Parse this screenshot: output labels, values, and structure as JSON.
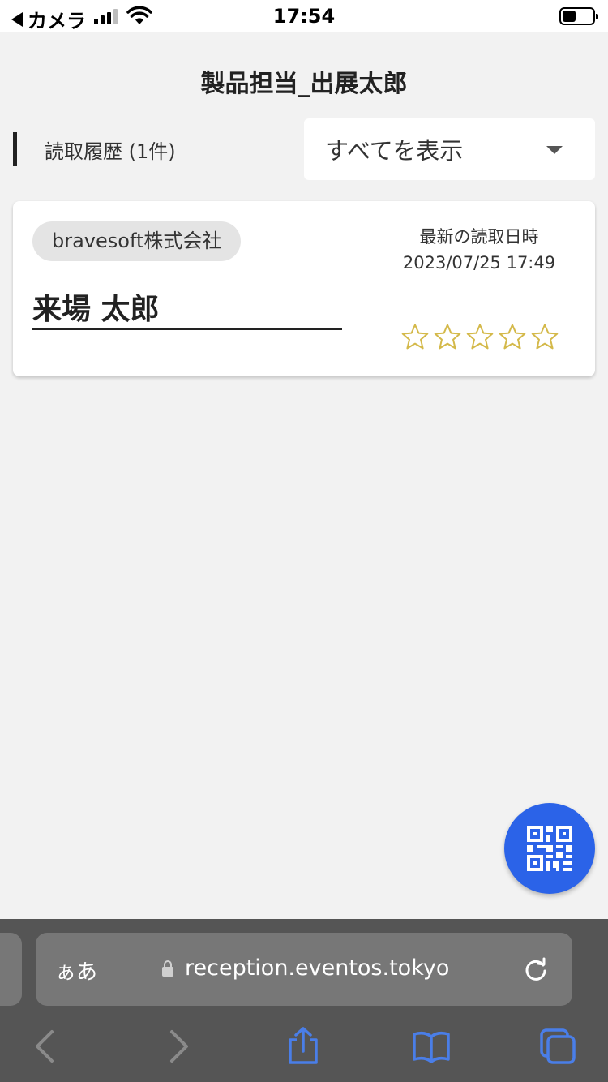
{
  "status_bar": {
    "back_label": "カメラ",
    "time": "17:54",
    "battery_fraction": 0.45
  },
  "header": {
    "title": "製品担当_出展太郎"
  },
  "history": {
    "label": "読取履歴 (1件)",
    "filter": {
      "selected": "すべてを表示"
    }
  },
  "visitors": [
    {
      "company": "bravesoft株式会社",
      "name": "来場 太郎",
      "latest_label": "最新の読取日時",
      "latest_datetime": "2023/07/25 17:49",
      "rating": 0,
      "rating_max": 5
    }
  ],
  "browser": {
    "aa_label": "ぁあ",
    "url": "reception.eventos.tokyo"
  },
  "colors": {
    "accent": "#2b63e8",
    "star": "#d4b94a",
    "toolbar_icon": "#4a7ee8",
    "toolbar_icon_disabled": "#8a8a8a"
  }
}
